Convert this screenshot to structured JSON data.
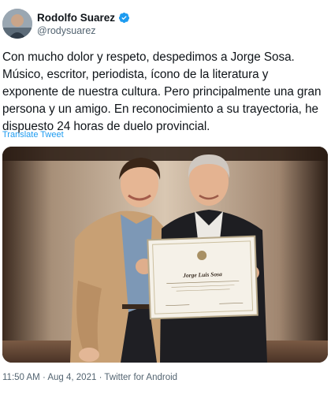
{
  "tweet": {
    "author_name": "Rodolfo Suarez",
    "author_handle": "@rodysuarez",
    "text": "Con mucho dolor y respeto, despedimos a Jorge Sosa. Músico, escritor, periodista, ícono de la literatura y exponente de nuestra cultura. Pero principalmente una gran persona y un amigo. En reconocimiento a su trayectoria, he dispuesto 24 horas de duelo provincial.",
    "translate_label": "Translate Tweet",
    "time": "11:50 AM",
    "date": "Aug 4, 2021",
    "source": "Twitter for Android",
    "separator": " · "
  },
  "photo": {
    "certificate_name": "Jorge Luis Sosa"
  },
  "colors": {
    "link": "#1d9bf0",
    "secondary_text": "#536471",
    "verified": "#1d9bf0"
  }
}
